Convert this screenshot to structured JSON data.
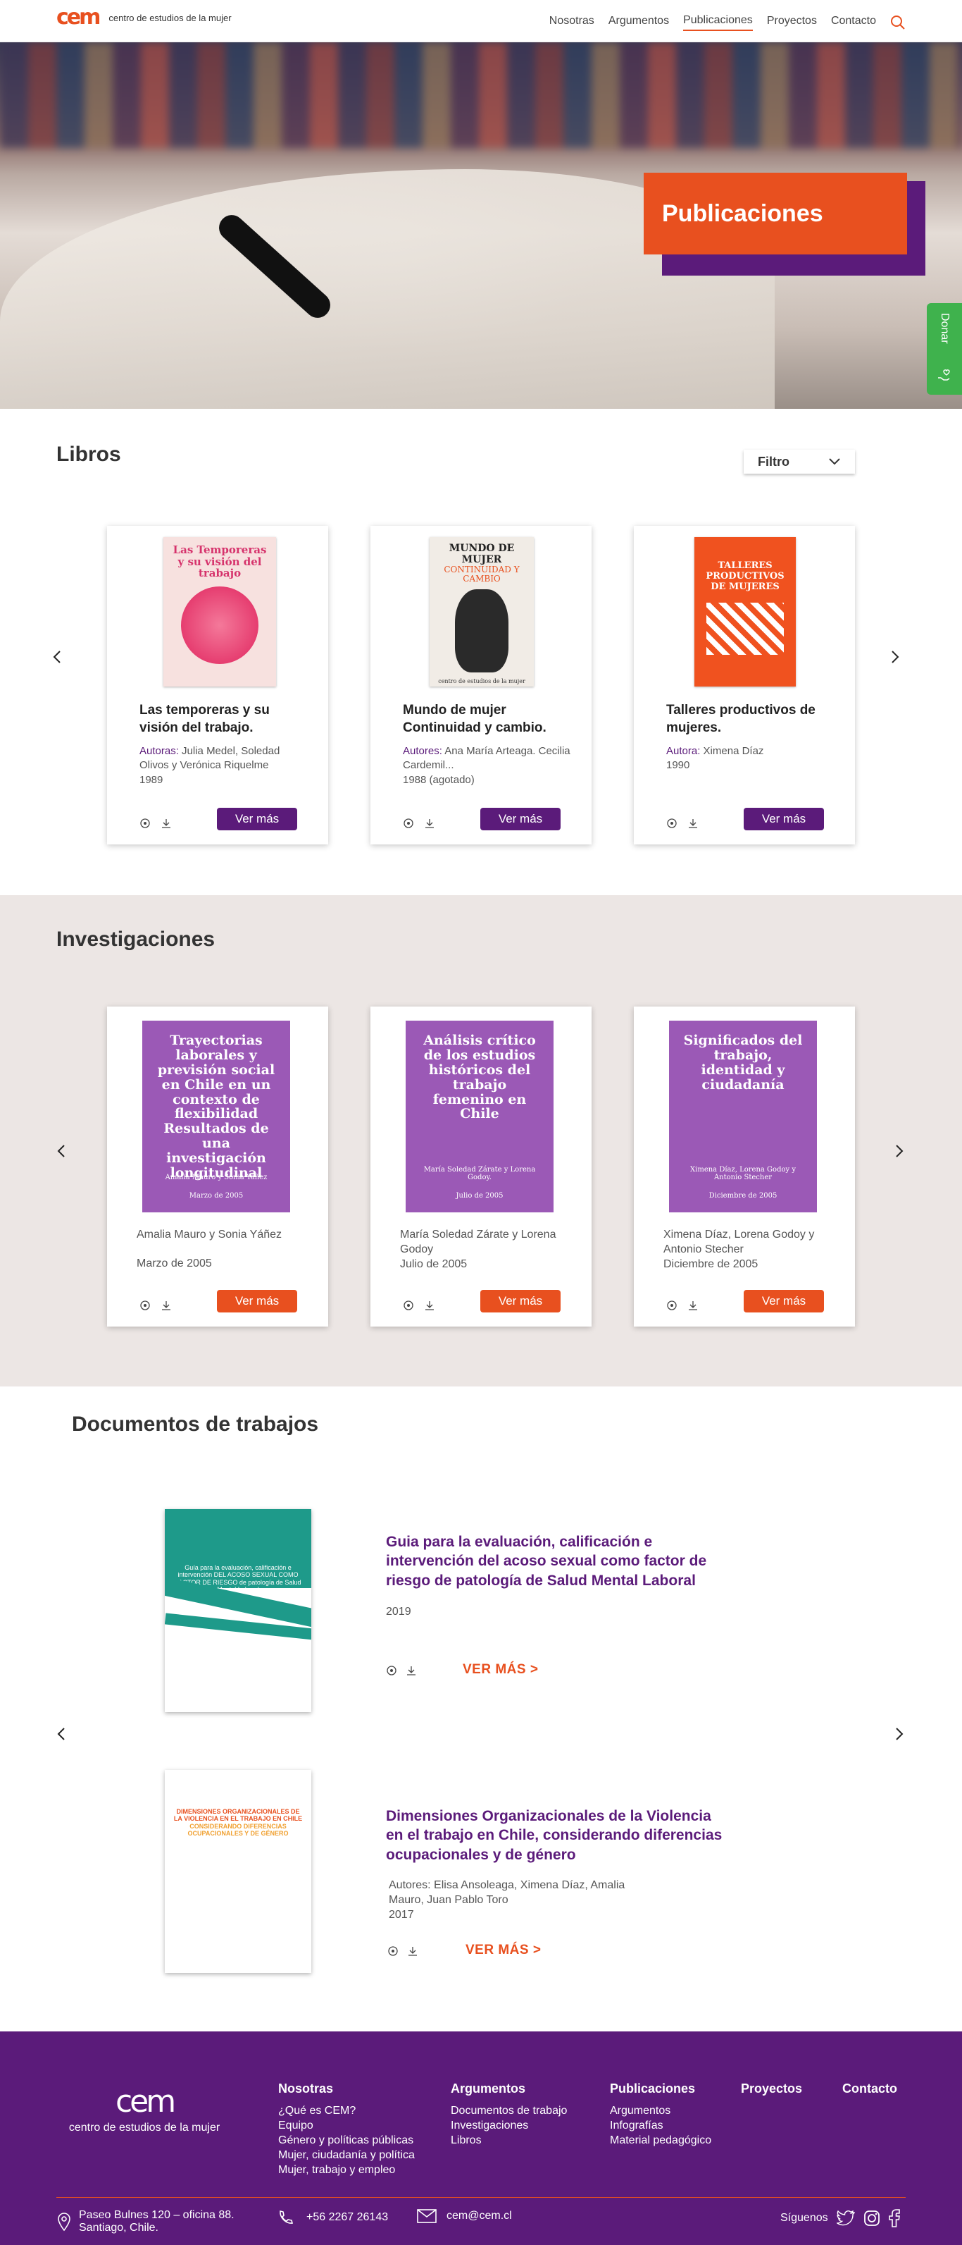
{
  "header": {
    "logo": "cem",
    "logo_text": "centro de estudios de la mujer",
    "nav": [
      "Nosotras",
      "Argumentos",
      "Publicaciones",
      "Proyectos",
      "Contacto"
    ],
    "active": "Publicaciones",
    "search_icon": "search-icon"
  },
  "hero": {
    "title": "Publicaciones"
  },
  "donar": {
    "label": "Donar",
    "icon": "hand-heart-icon"
  },
  "libros": {
    "title": "Libros",
    "filter_label": "Filtro",
    "cards": [
      {
        "cover_title": "Las Temporeras y su visión del trabajo",
        "title": "Las temporeras  y su visión del trabajo.",
        "label": "Autoras:",
        "authors": "Julia Medel, Soledad Olivos y Verónica Riquelme",
        "year": "1989",
        "button": "Ver más"
      },
      {
        "cover_title": "MUNDO DE MUJER",
        "cover_sub": "CONTINUIDAD Y CAMBIO",
        "cover_foot": "centro de estudios de la mujer",
        "title": "Mundo de mujer Continuidad y cambio.",
        "label": "Autores:",
        "authors": "Ana María Arteaga. Cecilia Cardemil...",
        "year": "1988 (agotado)",
        "button": "Ver más"
      },
      {
        "cover_title": "TALLERES PRODUCTIVOS DE MUJERES",
        "title": "Talleres productivos de mujeres.",
        "label": "Autora:",
        "authors": "Ximena Díaz",
        "year": "1990",
        "button": "Ver más"
      }
    ]
  },
  "investigaciones": {
    "title": "Investigaciones",
    "cards": [
      {
        "cover_title": "Trayectorias laborales y previsión social en Chile en un contexto de flexibilidad Resultados de una investigación longitudinal",
        "cover_authors": "Amalia Mauro y Sonia Yáñez",
        "cover_date": "Marzo de 2005",
        "authors": "Amalia Mauro y Sonia Yáñez",
        "date": "Marzo de 2005",
        "button": "Ver más"
      },
      {
        "cover_title": "Análisis crítico de los estudios históricos del trabajo femenino en Chile",
        "cover_authors": "María Soledad Zárate y Lorena Godoy.",
        "cover_date": "Julio de 2005",
        "authors": "María Soledad Zárate y Lorena Godoy",
        "date": "Julio de 2005",
        "button": "Ver más"
      },
      {
        "cover_title": "Significados del trabajo, identidad y ciudadanía",
        "cover_authors": "Ximena Díaz, Lorena Godoy y Antonio Stecher",
        "cover_date": "Diciembre de 2005",
        "authors": "Ximena Díaz, Lorena Godoy y Antonio Stecher",
        "date": "Diciembre de 2005",
        "button": "Ver más"
      }
    ]
  },
  "documentos": {
    "title": "Documentos de trabajos",
    "items": [
      {
        "cover_title": "Guía para la evaluación, calificación e intervención DEL ACOSO SEXUAL COMO FACTOR DE RIESGO de patología de Salud Mental Laboral",
        "title": "Guia para la evaluación, calificación e intervención del acoso sexual como factor de riesgo de patología de Salud Mental Laboral",
        "meta": "2019",
        "button": "VER MÁS"
      },
      {
        "cover_title": "DIMENSIONES ORGANIZACIONALES DE LA VIOLENCIA EN EL TRABAJO EN CHILE",
        "cover_sub": "CONSIDERANDO DIFERENCIAS OCUPACIONALES Y DE GÉNERO",
        "title": "Dimensiones Organizacionales de la Violencia en el trabajo en Chile, considerando diferencias ocupacionales y de género",
        "meta": "Autores: Elisa Ansoleaga, Ximena Díaz, Amalia Mauro, Juan Pablo Toro",
        "year": "2017",
        "button": "VER MÁS"
      }
    ]
  },
  "footer": {
    "logo": "cem",
    "logo_text": "centro de estudios de la mujer",
    "columns": [
      {
        "heading": "Nosotras",
        "links": [
          "¿Qué es CEM?",
          "Equipo",
          "Género y políticas públicas",
          "Mujer, ciudadanía y política",
          "Mujer, trabajo y empleo"
        ]
      },
      {
        "heading": "Argumentos",
        "links": [
          "Documentos de trabajo",
          "Investigaciones",
          "Libros"
        ]
      },
      {
        "heading": "Publicaciones",
        "links": [
          "Argumentos",
          "Infografías",
          "Material pedagógico"
        ]
      },
      {
        "heading": "Proyectos",
        "links": []
      },
      {
        "heading": "Contacto",
        "links": []
      }
    ],
    "address": "Paseo Bulnes 120 – oficina 88. Santiago, Chile.",
    "phone": "+56 2267 26143",
    "email": "cem@cem.cl",
    "follow": "Síguenos",
    "colors": {
      "primary": "#5b1b7a",
      "accent": "#e8501f",
      "donate": "#3fb24d"
    }
  }
}
